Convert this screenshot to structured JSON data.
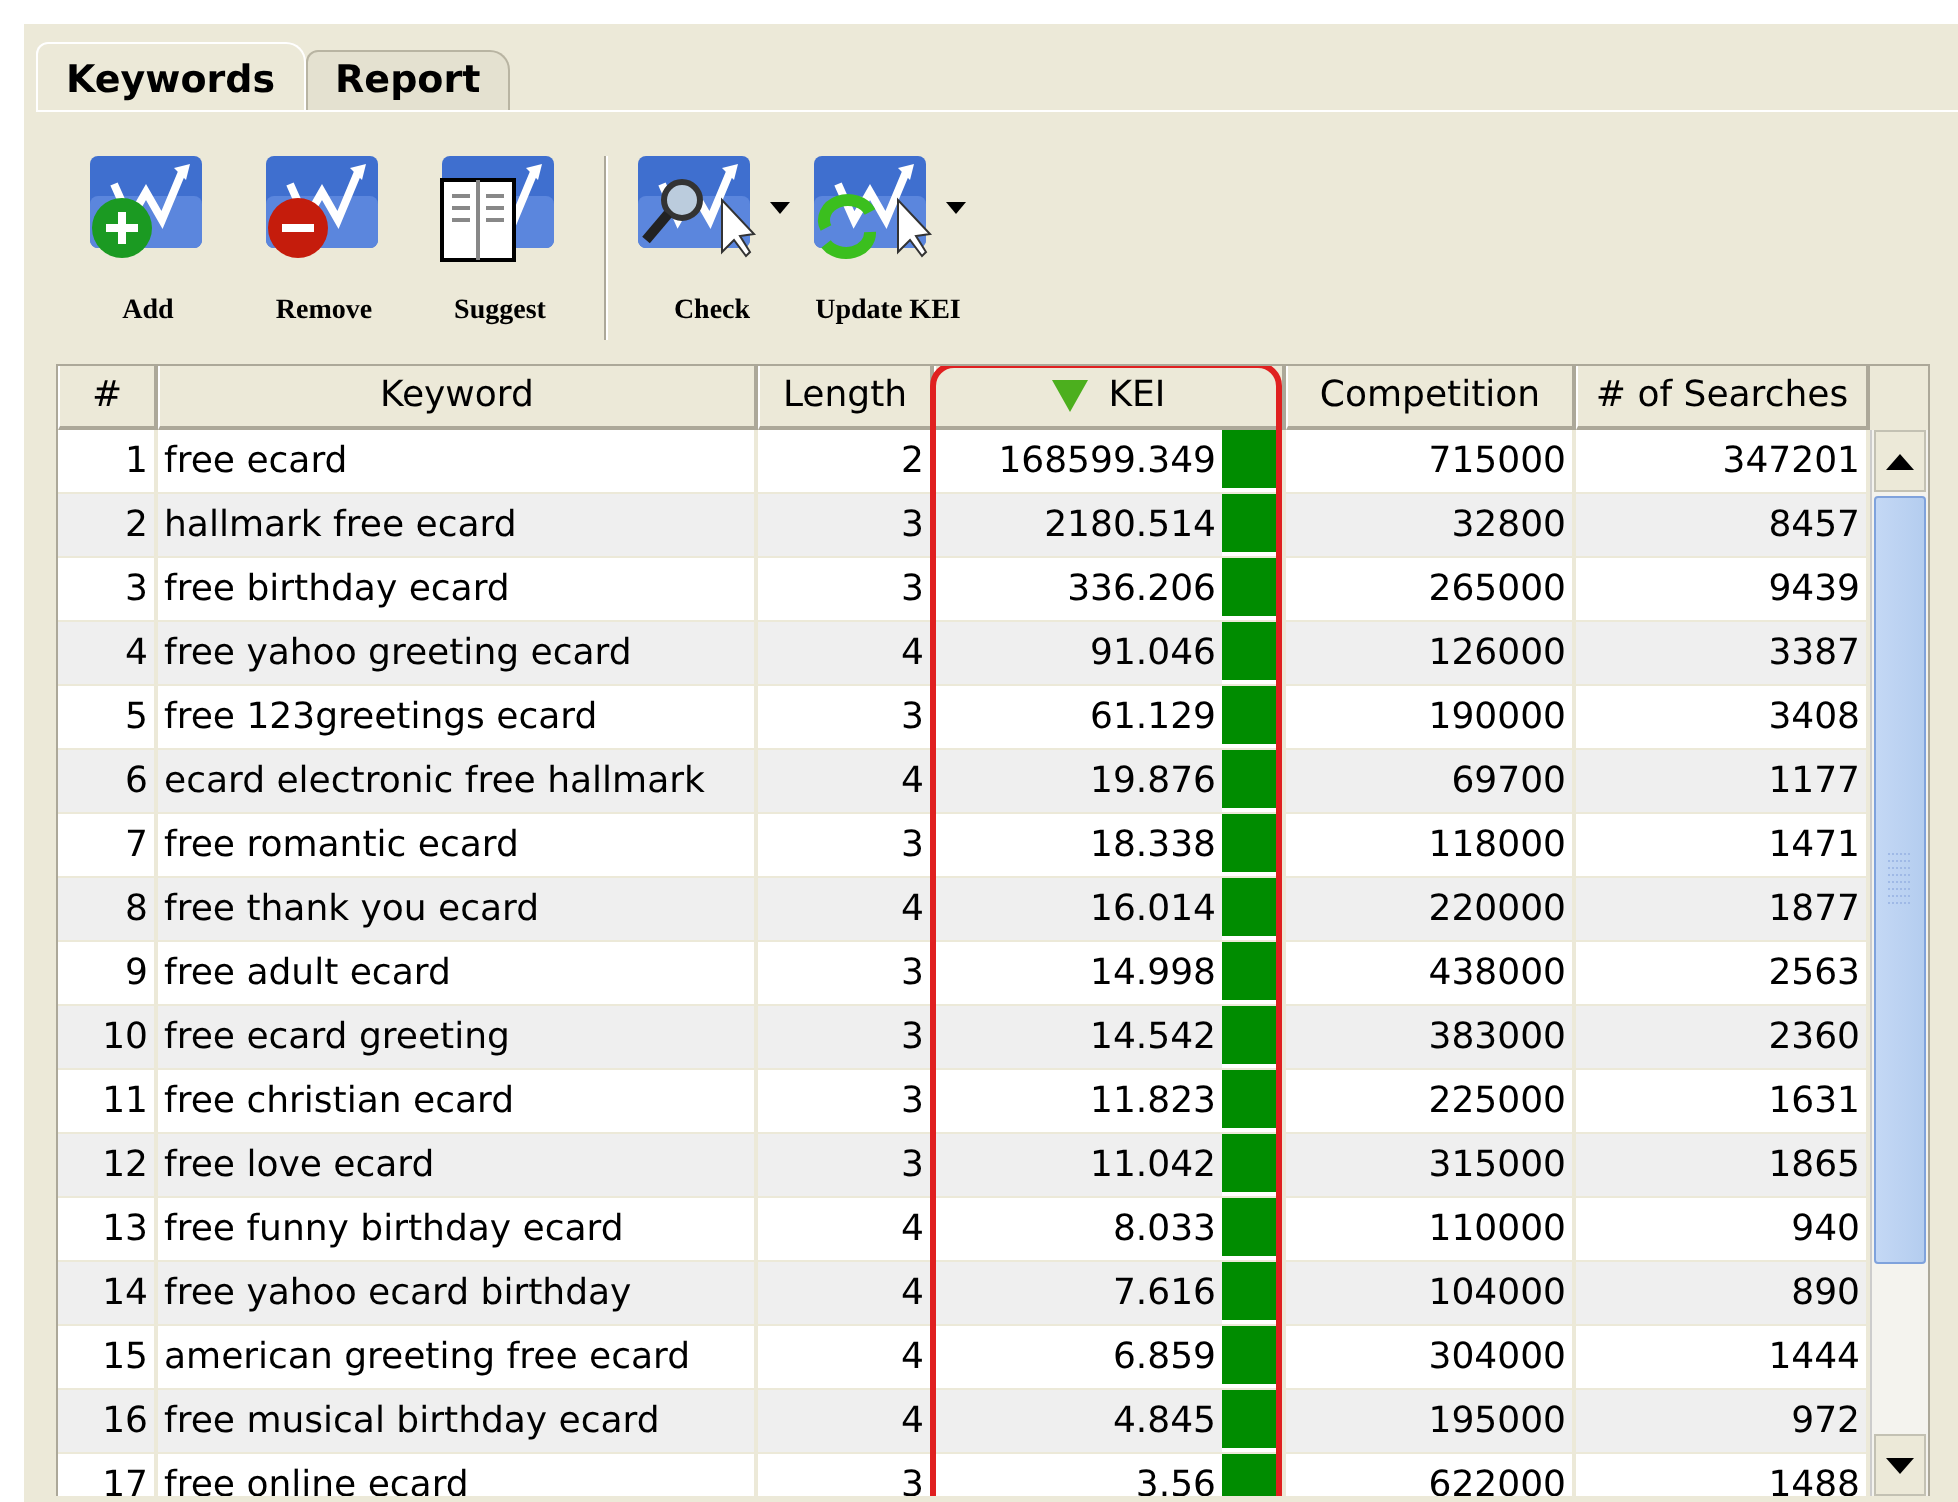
{
  "tabs": [
    {
      "label": "Keywords",
      "selected": true
    },
    {
      "label": "Report",
      "selected": false
    }
  ],
  "toolbar": [
    {
      "kind": "add",
      "label": "Add",
      "dropdown": false
    },
    {
      "kind": "remove",
      "label": "Remove",
      "dropdown": false
    },
    {
      "kind": "suggest",
      "label": "Suggest",
      "dropdown": false
    },
    {
      "kind": "check",
      "label": "Check",
      "dropdown": true
    },
    {
      "kind": "update",
      "label": "Update KEI",
      "dropdown": true
    }
  ],
  "table": {
    "columns": [
      {
        "label": "#",
        "sorted": false,
        "highlighted": false
      },
      {
        "label": "Keyword",
        "sorted": false,
        "highlighted": false
      },
      {
        "label": "Length",
        "sorted": false,
        "highlighted": false
      },
      {
        "label": "KEI",
        "sorted": true,
        "highlighted": true
      },
      {
        "label": "Competition",
        "sorted": false,
        "highlighted": false
      },
      {
        "label": "# of Searches",
        "sorted": false,
        "highlighted": false
      }
    ],
    "rows": [
      [
        "1",
        "free ecard",
        "2",
        "168599.349",
        "715000",
        "347201"
      ],
      [
        "2",
        "hallmark free ecard",
        "3",
        "2180.514",
        "32800",
        "8457"
      ],
      [
        "3",
        "free birthday ecard",
        "3",
        "336.206",
        "265000",
        "9439"
      ],
      [
        "4",
        "free yahoo greeting ecard",
        "4",
        "91.046",
        "126000",
        "3387"
      ],
      [
        "5",
        "free 123greetings ecard",
        "3",
        "61.129",
        "190000",
        "3408"
      ],
      [
        "6",
        "ecard electronic free hallmark",
        "4",
        "19.876",
        "69700",
        "1177"
      ],
      [
        "7",
        "free romantic ecard",
        "3",
        "18.338",
        "118000",
        "1471"
      ],
      [
        "8",
        "free thank you ecard",
        "4",
        "16.014",
        "220000",
        "1877"
      ],
      [
        "9",
        "free adult ecard",
        "3",
        "14.998",
        "438000",
        "2563"
      ],
      [
        "10",
        "free ecard greeting",
        "3",
        "14.542",
        "383000",
        "2360"
      ],
      [
        "11",
        "free christian ecard",
        "3",
        "11.823",
        "225000",
        "1631"
      ],
      [
        "12",
        "free love ecard",
        "3",
        "11.042",
        "315000",
        "1865"
      ],
      [
        "13",
        "free funny birthday ecard",
        "4",
        "8.033",
        "110000",
        "940"
      ],
      [
        "14",
        "free yahoo ecard birthday",
        "4",
        "7.616",
        "104000",
        "890"
      ],
      [
        "15",
        "american greeting free ecard",
        "4",
        "6.859",
        "304000",
        "1444"
      ],
      [
        "16",
        "free musical birthday ecard",
        "4",
        "4.845",
        "195000",
        "972"
      ],
      [
        "17",
        "free online ecard",
        "3",
        "3.56",
        "622000",
        "1488"
      ]
    ]
  }
}
